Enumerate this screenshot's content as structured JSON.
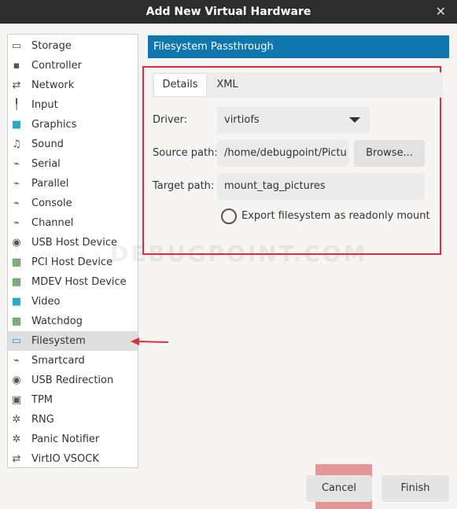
{
  "window": {
    "title": "Add New Virtual Hardware",
    "close_glyph": "✕"
  },
  "sidebar": {
    "selected_index": 15,
    "items": [
      {
        "label": "Storage",
        "icon": "storage-icon"
      },
      {
        "label": "Controller",
        "icon": "controller-icon"
      },
      {
        "label": "Network",
        "icon": "network-icon"
      },
      {
        "label": "Input",
        "icon": "input-icon"
      },
      {
        "label": "Graphics",
        "icon": "graphics-icon"
      },
      {
        "label": "Sound",
        "icon": "sound-icon"
      },
      {
        "label": "Serial",
        "icon": "serial-icon"
      },
      {
        "label": "Parallel",
        "icon": "parallel-icon"
      },
      {
        "label": "Console",
        "icon": "console-icon"
      },
      {
        "label": "Channel",
        "icon": "channel-icon"
      },
      {
        "label": "USB Host Device",
        "icon": "usb-host-device-icon"
      },
      {
        "label": "PCI Host Device",
        "icon": "pci-host-device-icon"
      },
      {
        "label": "MDEV Host Device",
        "icon": "mdev-host-device-icon"
      },
      {
        "label": "Video",
        "icon": "video-icon"
      },
      {
        "label": "Watchdog",
        "icon": "watchdog-icon"
      },
      {
        "label": "Filesystem",
        "icon": "filesystem-icon"
      },
      {
        "label": "Smartcard",
        "icon": "smartcard-icon"
      },
      {
        "label": "USB Redirection",
        "icon": "usb-redirection-icon"
      },
      {
        "label": "TPM",
        "icon": "tpm-icon"
      },
      {
        "label": "RNG",
        "icon": "rng-icon"
      },
      {
        "label": "Panic Notifier",
        "icon": "panic-notifier-icon"
      },
      {
        "label": "VirtIO VSOCK",
        "icon": "virtio-vsock-icon"
      }
    ]
  },
  "panel": {
    "header": "Filesystem Passthrough",
    "tabs": [
      {
        "label": "Details",
        "active": true
      },
      {
        "label": "XML",
        "active": false
      }
    ],
    "driver_label": "Driver:",
    "driver_value": "virtiofs",
    "source_label": "Source path:",
    "source_value": "/home/debugpoint/Pictu",
    "browse_label": "Browse...",
    "target_label": "Target path:",
    "target_value": "mount_tag_pictures",
    "readonly_label": "Export filesystem as readonly mount",
    "readonly_checked": false
  },
  "watermark": "DEBUGPOINT.COM",
  "footer": {
    "cancel_label": "Cancel",
    "finish_label": "Finish"
  },
  "colors": {
    "accent": "#0f76ae",
    "highlight": "#d9303f",
    "titlebar": "#2d2d2d"
  }
}
